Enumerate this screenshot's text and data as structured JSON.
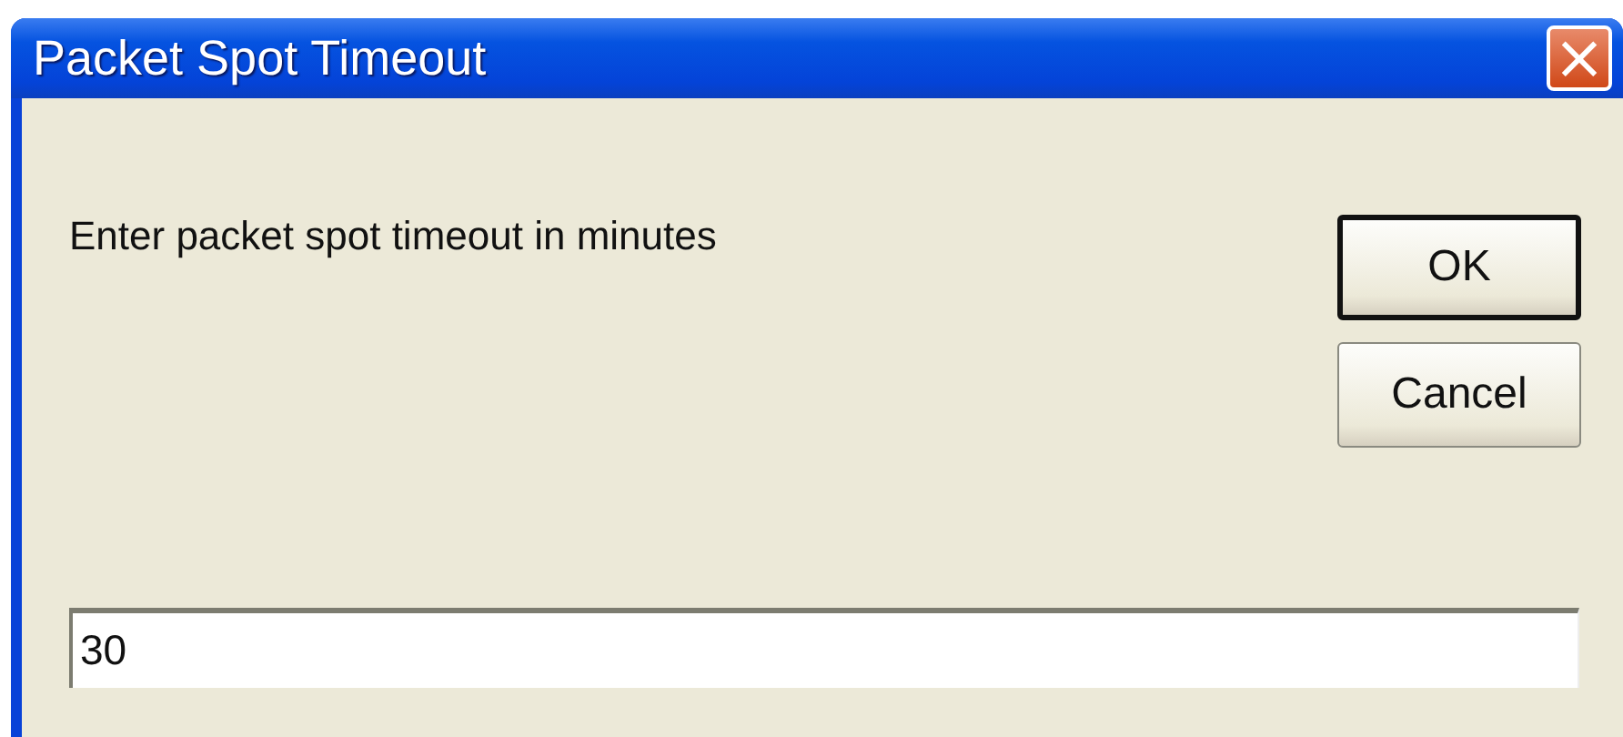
{
  "window": {
    "title": "Packet Spot Timeout",
    "close": "×"
  },
  "prompt": "Enter packet spot timeout in minutes",
  "buttons": [
    {
      "label": "OK",
      "default": true
    },
    {
      "label": "Cancel",
      "default": false
    }
  ],
  "input": {
    "value": "30"
  }
}
